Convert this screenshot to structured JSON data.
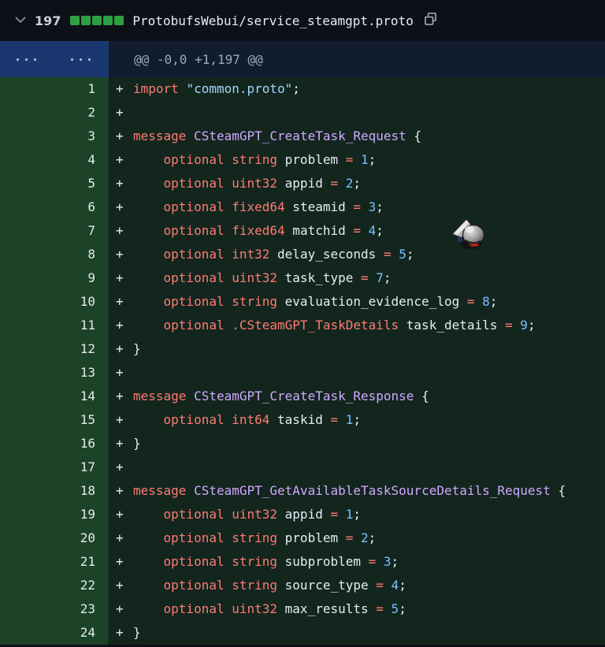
{
  "colors": {
    "page_bg": "#0d1117",
    "diffstat_green": "#2ea043",
    "hunk_gutter_bg": "#1a386f",
    "hunk_bg": "#111d2e",
    "addition_gutter_bg": "#1c4328",
    "addition_bg": "#12261e",
    "token_keyword": "#ff7b72",
    "token_entity": "#d2a8ff",
    "token_string": "#a5d6ff",
    "token_number": "#79c0ff",
    "token_plain": "#e6edf3"
  },
  "file_header": {
    "collapse_icon": "chevron-down-icon",
    "additions_count": "197",
    "diffstat_squares": 5,
    "filename": "ProtobufsWebui/service_steamgpt.proto",
    "copy_icon": "copy-icon"
  },
  "hunk": {
    "left_expander": "...",
    "right_expander": "...",
    "header": "@@ -0,0 +1,197 @@"
  },
  "code": {
    "sign": "+",
    "lines": [
      {
        "n": "1",
        "tokens": [
          [
            "k",
            "import"
          ],
          [
            "p",
            " "
          ],
          [
            "s",
            "\"common.proto\""
          ],
          [
            "p",
            ";"
          ]
        ]
      },
      {
        "n": "2",
        "tokens": []
      },
      {
        "n": "3",
        "tokens": [
          [
            "k",
            "message"
          ],
          [
            "p",
            " "
          ],
          [
            "e",
            "CSteamGPT_CreateTask_Request"
          ],
          [
            "p",
            " {"
          ]
        ]
      },
      {
        "n": "4",
        "tokens": [
          [
            "p",
            "    "
          ],
          [
            "k",
            "optional"
          ],
          [
            "p",
            " "
          ],
          [
            "k",
            "string"
          ],
          [
            "p",
            " problem "
          ],
          [
            "k",
            "="
          ],
          [
            "p",
            " "
          ],
          [
            "n",
            "1"
          ],
          [
            "p",
            ";"
          ]
        ]
      },
      {
        "n": "5",
        "tokens": [
          [
            "p",
            "    "
          ],
          [
            "k",
            "optional"
          ],
          [
            "p",
            " "
          ],
          [
            "k",
            "uint32"
          ],
          [
            "p",
            " appid "
          ],
          [
            "k",
            "="
          ],
          [
            "p",
            " "
          ],
          [
            "n",
            "2"
          ],
          [
            "p",
            ";"
          ]
        ]
      },
      {
        "n": "6",
        "tokens": [
          [
            "p",
            "    "
          ],
          [
            "k",
            "optional"
          ],
          [
            "p",
            " "
          ],
          [
            "k",
            "fixed64"
          ],
          [
            "p",
            " steamid "
          ],
          [
            "k",
            "="
          ],
          [
            "p",
            " "
          ],
          [
            "n",
            "3"
          ],
          [
            "p",
            ";"
          ]
        ]
      },
      {
        "n": "7",
        "tokens": [
          [
            "p",
            "    "
          ],
          [
            "k",
            "optional"
          ],
          [
            "p",
            " "
          ],
          [
            "k",
            "fixed64"
          ],
          [
            "p",
            " matchid "
          ],
          [
            "k",
            "="
          ],
          [
            "p",
            " "
          ],
          [
            "n",
            "4"
          ],
          [
            "p",
            ";"
          ]
        ]
      },
      {
        "n": "8",
        "tokens": [
          [
            "p",
            "    "
          ],
          [
            "k",
            "optional"
          ],
          [
            "p",
            " "
          ],
          [
            "k",
            "int32"
          ],
          [
            "p",
            " delay_seconds "
          ],
          [
            "k",
            "="
          ],
          [
            "p",
            " "
          ],
          [
            "n",
            "5"
          ],
          [
            "p",
            ";"
          ]
        ]
      },
      {
        "n": "9",
        "tokens": [
          [
            "p",
            "    "
          ],
          [
            "k",
            "optional"
          ],
          [
            "p",
            " "
          ],
          [
            "k",
            "uint32"
          ],
          [
            "p",
            " task_type "
          ],
          [
            "k",
            "="
          ],
          [
            "p",
            " "
          ],
          [
            "n",
            "7"
          ],
          [
            "p",
            ";"
          ]
        ]
      },
      {
        "n": "10",
        "tokens": [
          [
            "p",
            "    "
          ],
          [
            "k",
            "optional"
          ],
          [
            "p",
            " "
          ],
          [
            "k",
            "string"
          ],
          [
            "p",
            " evaluation_evidence_log "
          ],
          [
            "k",
            "="
          ],
          [
            "p",
            " "
          ],
          [
            "n",
            "8"
          ],
          [
            "p",
            ";"
          ]
        ]
      },
      {
        "n": "11",
        "tokens": [
          [
            "p",
            "    "
          ],
          [
            "k",
            "optional"
          ],
          [
            "p",
            " "
          ],
          [
            "k",
            ".CSteamGPT_TaskDetails"
          ],
          [
            "p",
            " task_details "
          ],
          [
            "k",
            "="
          ],
          [
            "p",
            " "
          ],
          [
            "n",
            "9"
          ],
          [
            "p",
            ";"
          ]
        ]
      },
      {
        "n": "12",
        "tokens": [
          [
            "p",
            "}"
          ]
        ]
      },
      {
        "n": "13",
        "tokens": []
      },
      {
        "n": "14",
        "tokens": [
          [
            "k",
            "message"
          ],
          [
            "p",
            " "
          ],
          [
            "e",
            "CSteamGPT_CreateTask_Response"
          ],
          [
            "p",
            " {"
          ]
        ]
      },
      {
        "n": "15",
        "tokens": [
          [
            "p",
            "    "
          ],
          [
            "k",
            "optional"
          ],
          [
            "p",
            " "
          ],
          [
            "k",
            "int64"
          ],
          [
            "p",
            " taskid "
          ],
          [
            "k",
            "="
          ],
          [
            "p",
            " "
          ],
          [
            "n",
            "1"
          ],
          [
            "p",
            ";"
          ]
        ]
      },
      {
        "n": "16",
        "tokens": [
          [
            "p",
            "}"
          ]
        ]
      },
      {
        "n": "17",
        "tokens": []
      },
      {
        "n": "18",
        "tokens": [
          [
            "k",
            "message"
          ],
          [
            "p",
            " "
          ],
          [
            "e",
            "CSteamGPT_GetAvailableTaskSourceDetails_Request"
          ],
          [
            "p",
            " {"
          ]
        ]
      },
      {
        "n": "19",
        "tokens": [
          [
            "p",
            "    "
          ],
          [
            "k",
            "optional"
          ],
          [
            "p",
            " "
          ],
          [
            "k",
            "uint32"
          ],
          [
            "p",
            " appid "
          ],
          [
            "k",
            "="
          ],
          [
            "p",
            " "
          ],
          [
            "n",
            "1"
          ],
          [
            "p",
            ";"
          ]
        ]
      },
      {
        "n": "20",
        "tokens": [
          [
            "p",
            "    "
          ],
          [
            "k",
            "optional"
          ],
          [
            "p",
            " "
          ],
          [
            "k",
            "string"
          ],
          [
            "p",
            " problem "
          ],
          [
            "k",
            "="
          ],
          [
            "p",
            " "
          ],
          [
            "n",
            "2"
          ],
          [
            "p",
            ";"
          ]
        ]
      },
      {
        "n": "21",
        "tokens": [
          [
            "p",
            "    "
          ],
          [
            "k",
            "optional"
          ],
          [
            "p",
            " "
          ],
          [
            "k",
            "string"
          ],
          [
            "p",
            " subproblem "
          ],
          [
            "k",
            "="
          ],
          [
            "p",
            " "
          ],
          [
            "n",
            "3"
          ],
          [
            "p",
            ";"
          ]
        ]
      },
      {
        "n": "22",
        "tokens": [
          [
            "p",
            "    "
          ],
          [
            "k",
            "optional"
          ],
          [
            "p",
            " "
          ],
          [
            "k",
            "string"
          ],
          [
            "p",
            " source_type "
          ],
          [
            "k",
            "="
          ],
          [
            "p",
            " "
          ],
          [
            "n",
            "4"
          ],
          [
            "p",
            ";"
          ]
        ]
      },
      {
        "n": "23",
        "tokens": [
          [
            "p",
            "    "
          ],
          [
            "k",
            "optional"
          ],
          [
            "p",
            " "
          ],
          [
            "k",
            "uint32"
          ],
          [
            "p",
            " max_results "
          ],
          [
            "k",
            "="
          ],
          [
            "p",
            " "
          ],
          [
            "n",
            "5"
          ],
          [
            "p",
            ";"
          ]
        ]
      },
      {
        "n": "24",
        "tokens": [
          [
            "p",
            "}"
          ]
        ]
      }
    ]
  },
  "cursor": {
    "icon": "metallic-gauntlet-cursor"
  }
}
